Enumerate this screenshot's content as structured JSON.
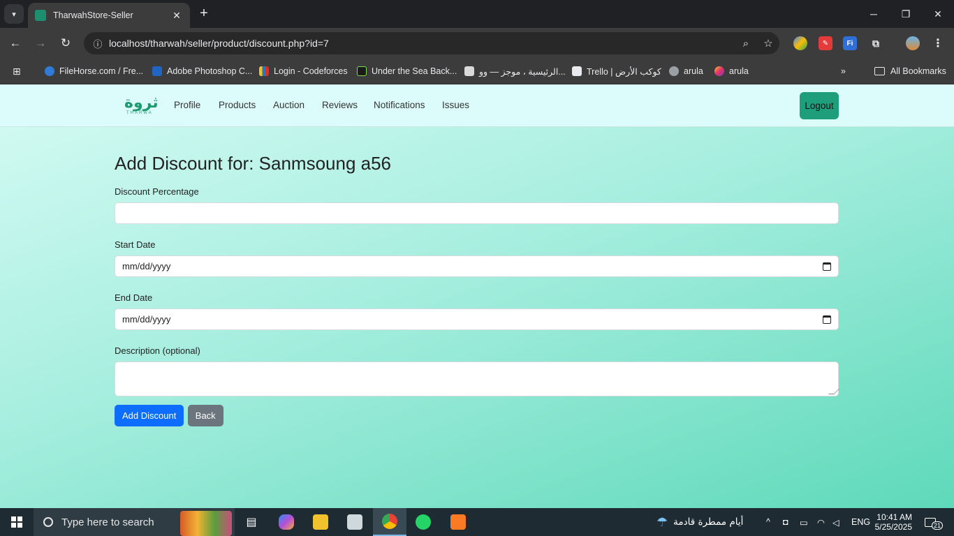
{
  "browser": {
    "tab_title": "TharwahStore-Seller",
    "tab_favicon": "ثروة",
    "url": "localhost/tharwah/seller/product/discount.php?id=7",
    "bookmarks": [
      "FileHorse.com / Fre...",
      "Adobe Photoshop C...",
      "Login - Codeforces",
      "Under the Sea Back...",
      "الرئيسية ، موجز — وو...",
      "Trello | كوكب الأرض",
      "arula",
      "arula"
    ],
    "all_bookmarks": "All Bookmarks",
    "chevron": "»"
  },
  "site": {
    "logo_ar": "ثروة",
    "logo_en": "THARWA",
    "nav": [
      "Profile",
      "Products",
      "Auction",
      "Reviews",
      "Notifications",
      "Issues"
    ],
    "logout": "Logout"
  },
  "form": {
    "heading": "Add Discount for: Sanmsoung a56",
    "discount_label": "Discount Percentage",
    "discount_value": "",
    "start_label": "Start Date",
    "start_placeholder": "mm/dd/yyyy",
    "end_label": "End Date",
    "end_placeholder": "mm/dd/yyyy",
    "description_label": "Description (optional)",
    "description_value": "",
    "add_button": "Add Discount",
    "back_button": "Back"
  },
  "taskbar": {
    "search_placeholder": "Type here to search",
    "weather": "أيام ممطرة قادمة",
    "language": "ENG",
    "time": "10:41 AM",
    "date": "5/25/2025",
    "notifications": "21"
  },
  "colors": {
    "accent": "#1f9e7c",
    "primary_button": "#0d6efd",
    "secondary_button": "#6c757d"
  }
}
